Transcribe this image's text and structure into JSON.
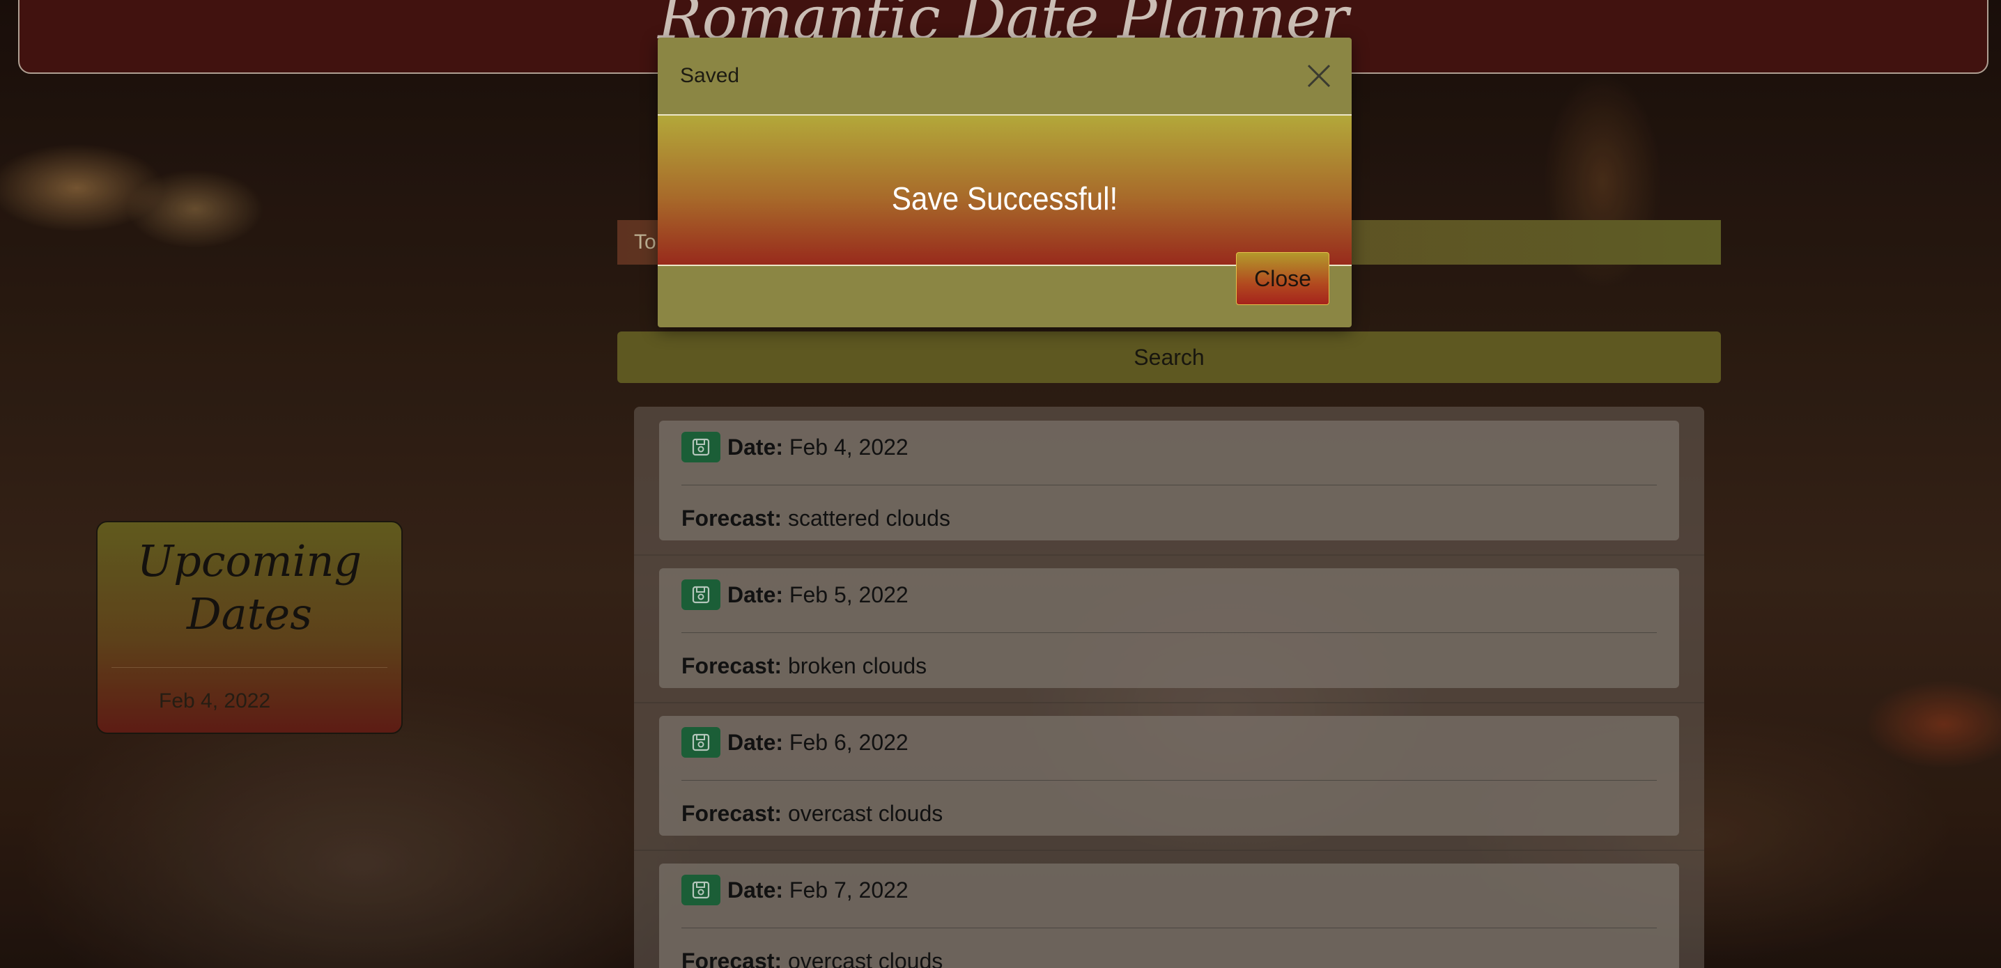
{
  "header": {
    "title": "Romantic Date Planner"
  },
  "form": {
    "topic_text": "To",
    "search_label": "Search"
  },
  "results": [
    {
      "date_label": "Date:",
      "date": "Feb 4, 2022",
      "forecast_label": "Forecast:",
      "forecast": "scattered clouds"
    },
    {
      "date_label": "Date:",
      "date": "Feb 5, 2022",
      "forecast_label": "Forecast:",
      "forecast": "broken clouds"
    },
    {
      "date_label": "Date:",
      "date": "Feb 6, 2022",
      "forecast_label": "Forecast:",
      "forecast": "overcast clouds"
    },
    {
      "date_label": "Date:",
      "date": "Feb 7, 2022",
      "forecast_label": "Forecast:",
      "forecast": "overcast clouds"
    }
  ],
  "upcoming": {
    "title_line1": "Upcoming",
    "title_line2": "Dates",
    "items": [
      "Feb 4, 2022"
    ]
  },
  "modal": {
    "title": "Saved",
    "message": "Save Successful!",
    "close_label": "Close",
    "close_icon": "close-icon"
  },
  "icons": {
    "save": "floppy-disk-icon"
  },
  "colors": {
    "header_bg": "#4a1512",
    "modal_bg": "#8b8644",
    "save_button": "#1f6b3f",
    "search_button": "#6b6526"
  }
}
